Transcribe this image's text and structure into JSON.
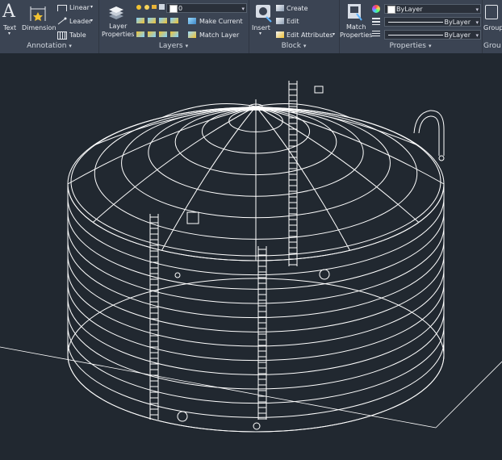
{
  "annotation": {
    "title": "Annotation",
    "text_label": "Text",
    "dimension_label": "Dimension",
    "linear_label": "Linear",
    "leader_label": "Leader",
    "table_label": "Table"
  },
  "layers": {
    "title": "Layers",
    "layer_properties_label": "Layer\nProperties",
    "current_layer": "0",
    "make_current_label": "Make Current",
    "match_layer_label": "Match Layer"
  },
  "block": {
    "title": "Block",
    "insert_label": "Insert",
    "create_label": "Create",
    "edit_label": "Edit",
    "edit_attributes_label": "Edit Attributes"
  },
  "properties": {
    "title": "Properties",
    "match_properties_label": "Match\nProperties",
    "color_value": "ByLayer",
    "linetype_value": "ByLayer",
    "lineweight_value": "ByLayer"
  },
  "groups": {
    "group_label": "Group",
    "title": "Grou"
  },
  "colors": {
    "ribbon_bg": "#3b4453",
    "canvas_bg": "#212830",
    "wire": "#ffffff"
  }
}
